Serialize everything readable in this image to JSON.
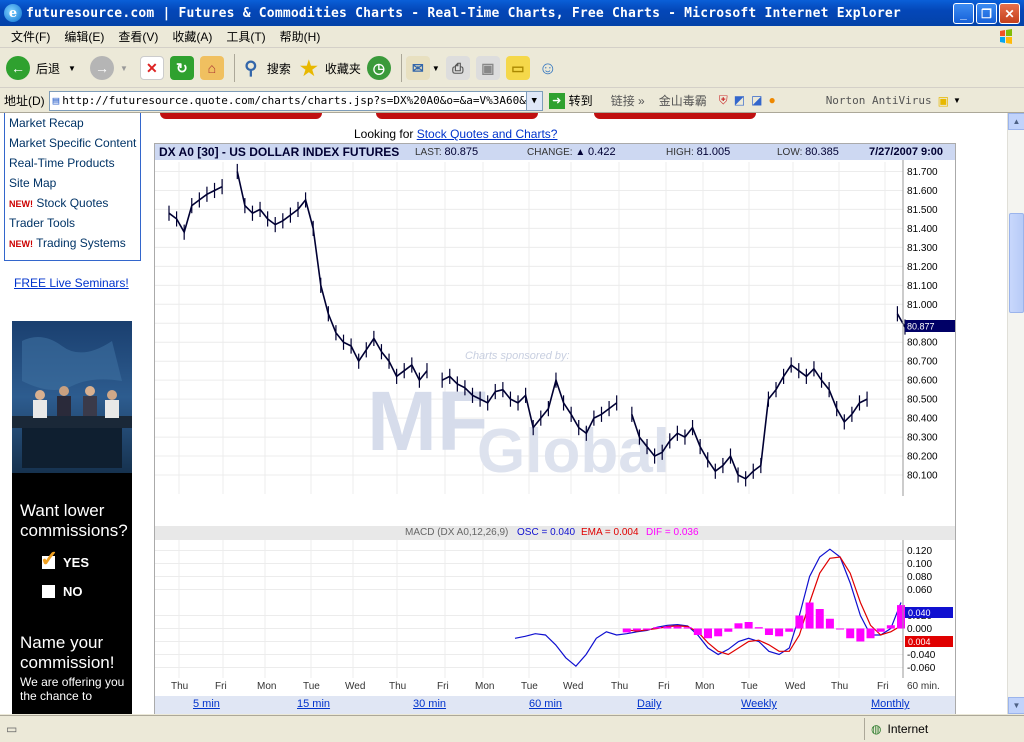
{
  "window": {
    "title": "futuresource.com | Futures & Commodities Charts - Real-Time Charts, Free Charts - Microsoft Internet Explorer"
  },
  "menu": [
    "文件(F)",
    "编辑(E)",
    "查看(V)",
    "收藏(A)",
    "工具(T)",
    "帮助(H)"
  ],
  "toolbar": {
    "back_label": "后退",
    "search_label": "搜索",
    "favorites_label": "收藏夹"
  },
  "address": {
    "label": "地址(D)",
    "url": "http://futuresource.quote.com/charts/charts.jsp?s=DX%20A0&o=&a=V%3A60&z=800x",
    "go_label": "转到",
    "links_label": "链接",
    "jinshan_label": "金山毒霸",
    "norton_label": "Norton AntiVirus"
  },
  "status": {
    "zone": "Internet"
  },
  "leftnav": {
    "items": [
      {
        "label": "Market Recap",
        "new": ""
      },
      {
        "label": "Market Specific Content",
        "new": ""
      },
      {
        "label": "Real-Time Products",
        "new": ""
      },
      {
        "label": "Site Map",
        "new": ""
      },
      {
        "label": "Stock Quotes",
        "new": "NEW!"
      },
      {
        "label": "Trader Tools",
        "new": ""
      },
      {
        "label": "Trading Systems",
        "new": "NEW!"
      }
    ],
    "seminars": "FREE Live Seminars!"
  },
  "ad": {
    "want": "Want lower commissions?",
    "yes": "YES",
    "no": "NO",
    "name": "Name your commission!",
    "small": "We are offering you the chance to"
  },
  "looking": {
    "prefix": "Looking for ",
    "link": "Stock Quotes and Charts?"
  },
  "chart": {
    "symbol_title": "DX A0 [30] - US DOLLAR INDEX FUTURES",
    "last_label": "LAST:",
    "last": "80.875",
    "change_label": "CHANGE:",
    "change": "0.422",
    "high_label": "HIGH:",
    "high": "81.005",
    "low_label": "LOW:",
    "low": "80.385",
    "datetime": "7/27/2007 9:00",
    "sponsor": "Charts sponsored by:",
    "sponsor_brand_a": "MF",
    "sponsor_brand_b": "Global",
    "last_marker": "80.877",
    "macd_label_prefix": "MACD (DX A0,12,26,9) ",
    "osc_label": "OSC = 0.040",
    "ema_label": "EMA = 0.004",
    "dif_label": "DIF = 0.036",
    "osc_marker": "0.040",
    "ema_marker": "0.004",
    "colors": {
      "osc": "#1010d0",
      "ema": "#e00000",
      "dif": "#ff00ff",
      "price": "#000033"
    }
  },
  "chart_data": [
    {
      "type": "line",
      "title": "DX A0 [30] - US DOLLAR INDEX FUTURES",
      "ylim": [
        80.0,
        81.75
      ],
      "yticks": [
        "81.700",
        "81.600",
        "81.500",
        "81.400",
        "81.300",
        "81.200",
        "81.100",
        "81.000",
        "80.900",
        "80.800",
        "80.700",
        "80.600",
        "80.500",
        "80.400",
        "80.300",
        "80.200",
        "80.100"
      ],
      "x_labels": [
        "Thu",
        "Fri",
        "Mon",
        "Tue",
        "Wed",
        "Thu",
        "Fri",
        "Mon",
        "Tue",
        "Wed",
        "Thu",
        "Fri",
        "Mon",
        "Tue",
        "Wed",
        "Thu",
        "Fri",
        "60 min."
      ],
      "series": [
        {
          "values": [
            81.48,
            81.45,
            81.38,
            81.52,
            81.55,
            81.58,
            81.6,
            81.62,
            null,
            81.7,
            81.52,
            81.48,
            81.5,
            81.45,
            81.42,
            81.44,
            81.47,
            81.5,
            81.55,
            81.4,
            81.1,
            80.95,
            80.85,
            80.8,
            80.78,
            80.7,
            80.76,
            80.82,
            80.75,
            80.7,
            80.62,
            80.65,
            80.68,
            80.6,
            80.65,
            null,
            80.6,
            80.62,
            80.58,
            80.56,
            80.52,
            80.5,
            80.48,
            80.54,
            80.55,
            80.5,
            80.48,
            80.52,
            80.35,
            80.4,
            80.45,
            80.6,
            80.48,
            80.42,
            80.35,
            80.32,
            80.4,
            80.42,
            80.45,
            80.48,
            null,
            80.42,
            80.3,
            80.25,
            80.2,
            80.22,
            80.28,
            80.32,
            80.3,
            80.35,
            80.25,
            80.18,
            80.12,
            80.15,
            80.2,
            80.1,
            80.08,
            80.12,
            80.15,
            80.5,
            80.55,
            80.62,
            80.68,
            80.65,
            80.62,
            80.66,
            80.6,
            80.55,
            80.45,
            80.38,
            80.42,
            80.48,
            80.5,
            null,
            null,
            null,
            80.95,
            80.88
          ]
        }
      ]
    },
    {
      "type": "line",
      "title": "MACD (DX A0,12,26,9)",
      "ylim": [
        -0.07,
        0.13
      ],
      "yticks": [
        "0.120",
        "0.100",
        "0.080",
        "0.060",
        "0.020",
        "0.000",
        "-0.020",
        "-0.040",
        "-0.060"
      ],
      "series": [
        {
          "name": "OSC",
          "values": [
            -0.015,
            -0.012,
            -0.008,
            -0.01,
            -0.025,
            -0.045,
            -0.058,
            -0.04,
            -0.015,
            -0.005,
            -0.01,
            -0.008,
            -0.005,
            -0.003,
            0.002,
            0.005,
            0.006,
            0.004,
            -0.01,
            -0.03,
            -0.04,
            -0.032,
            -0.02,
            -0.015,
            -0.02,
            -0.035,
            -0.04,
            -0.03,
            0.02,
            0.08,
            0.11,
            0.122,
            0.11,
            0.07,
            0.02,
            -0.01,
            -0.01,
            0.0,
            0.04
          ]
        },
        {
          "name": "EMA",
          "values": [
            null,
            null,
            null,
            null,
            null,
            null,
            null,
            null,
            null,
            null,
            null,
            -0.002,
            -0.004,
            -0.002,
            0.0,
            0.003,
            0.004,
            0.003,
            -0.005,
            -0.022,
            -0.035,
            -0.04,
            -0.03,
            -0.02,
            -0.018,
            -0.025,
            -0.035,
            -0.035,
            -0.01,
            0.04,
            0.085,
            0.108,
            0.11,
            0.085,
            0.04,
            0.005,
            -0.01,
            -0.005,
            0.004
          ]
        },
        {
          "name": "DIF",
          "values": [
            null,
            null,
            null,
            null,
            null,
            null,
            null,
            null,
            null,
            null,
            null,
            -0.006,
            -0.003,
            -0.002,
            0.002,
            0.003,
            0.003,
            0.002,
            -0.01,
            -0.015,
            -0.012,
            -0.005,
            0.008,
            0.01,
            0.002,
            -0.01,
            -0.012,
            -0.005,
            0.02,
            0.04,
            0.03,
            0.015,
            0.0,
            -0.015,
            -0.02,
            -0.015,
            -0.005,
            0.005,
            0.036
          ]
        }
      ]
    }
  ],
  "intervals": [
    "5 min",
    "15 min",
    "30 min",
    "60 min",
    "Daily",
    "Weekly",
    "Monthly"
  ]
}
